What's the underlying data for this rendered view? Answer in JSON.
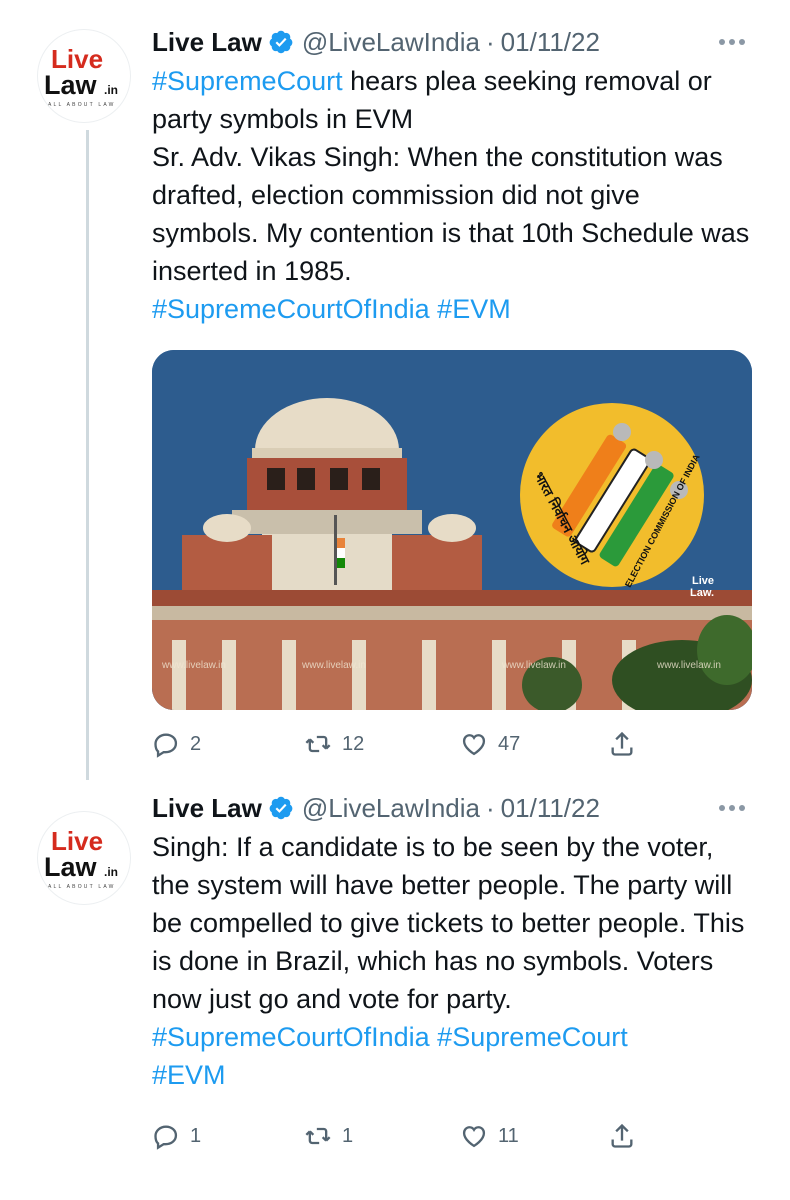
{
  "tweets": [
    {
      "author": {
        "name": "Live Law",
        "handle": "@LiveLawIndia",
        "separator": "·",
        "date": "01/11/22",
        "avatar": {
          "word1": "Live",
          "word2": "Law",
          "suffix": ".in",
          "tagline": "ALL ABOUT LAW"
        }
      },
      "text": {
        "tag1": "#SupremeCourt",
        "body": " hears plea seeking removal or party symbols in EVM\nSr. Adv. Vikas Singh: When the constitution was drafted, election commission did not give symbols. My contention is that 10th Schedule was inserted in 1985.\n",
        "tag2": "#SupremeCourtOfIndia",
        "tag3": "#EVM"
      },
      "media": {
        "watermark": "www.livelaw.in",
        "logo_text_hindi": "भारत निर्वाचन आयोग",
        "logo_text_english": "ELECTION COMMISSION OF INDIA",
        "brand1": "Live",
        "brand2": "Law."
      },
      "actions": {
        "replies": "2",
        "retweets": "12",
        "likes": "47"
      }
    },
    {
      "author": {
        "name": "Live Law",
        "handle": "@LiveLawIndia",
        "separator": "·",
        "date": "01/11/22",
        "avatar": {
          "word1": "Live",
          "word2": "Law",
          "suffix": ".in",
          "tagline": "ALL ABOUT LAW"
        }
      },
      "text": {
        "body": "Singh: If a candidate is to be seen by the voter, the system will have better people. The party will be compelled to give tickets to better people. This is done in Brazil, which has no symbols. Voters now just go and vote for party.\n",
        "tag1": "#SupremeCourtOfIndia",
        "tag2": "#SupremeCourt",
        "tag3": "#EVM"
      },
      "actions": {
        "replies": "1",
        "retweets": "1",
        "likes": "11"
      }
    }
  ],
  "colors": {
    "accent": "#1d9bf0",
    "brand_red": "#d52b1e",
    "muted": "#536471"
  },
  "icons": [
    "verified-badge-icon",
    "more-options-icon",
    "reply-icon",
    "retweet-icon",
    "like-icon",
    "share-icon"
  ]
}
